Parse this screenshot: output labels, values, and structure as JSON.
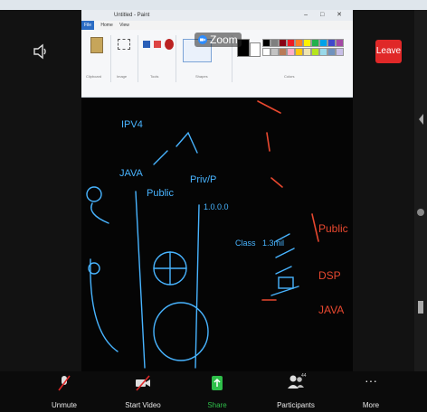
{
  "paint": {
    "title": "Untitled - Paint",
    "menu": {
      "file": "File",
      "items": [
        "Home",
        "View"
      ]
    },
    "groups": [
      "Clipboard",
      "Image",
      "Tools",
      "Shapes",
      "Colors"
    ]
  },
  "zoom_label": "Zoom",
  "leave_label": "Leave",
  "toolbar": {
    "unmute": "Unmute",
    "start_video": "Start Video",
    "share": "Share",
    "participants": "Participants",
    "participant_count": "44",
    "more": "More"
  },
  "colors": {
    "leave": "#e02828",
    "share": "#2fbf4a",
    "chalk_blue": "#48b4ff",
    "chalk_red": "#e8482f"
  },
  "whiteboard_text": {
    "t1": "IPV4",
    "t2": "JAVA",
    "t3": "Public",
    "t4": "Priv/P",
    "t5": "DSP",
    "t6": "JAVA",
    "t7": "Public",
    "t8": "1.0.0.0",
    "t9": "Class",
    "t10": "1.3mil"
  }
}
